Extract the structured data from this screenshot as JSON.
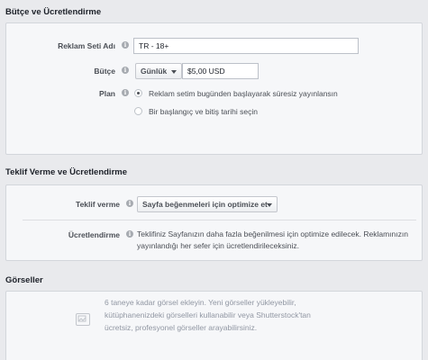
{
  "budget_section": {
    "title": "Bütçe ve Ücretlendirme",
    "ad_set_name_label": "Reklam Seti Adı",
    "ad_set_name_value": "TR - 18+",
    "budget_label": "Bütçe",
    "budget_type": "Günlük",
    "budget_amount": "$5,00 USD",
    "plan_label": "Plan",
    "plan_options": [
      {
        "label": "Reklam setim bugünden başlayarak süresiz yayınlansın",
        "selected": true
      },
      {
        "label": "Bir başlangıç ve bitiş tarihi seçin",
        "selected": false
      }
    ]
  },
  "bid_section": {
    "title": "Teklif Verme ve Ücretlendirme",
    "bid_label": "Teklif verme",
    "bid_value": "Sayfa beğenmeleri için optimize et",
    "charge_label": "Ücretlendirme",
    "charge_text_1": "Teklifiniz Sayfanızın daha fazla beğenilmesi için optimize edilecek. Reklamınızın",
    "charge_text_2": "yayınlandığı her sefer için ücretlendirileceksiniz."
  },
  "visuals_section": {
    "title": "Görseller",
    "upload_line_1": "6 taneye kadar görsel ekleyin. Yeni görseller yükleyebilir,",
    "upload_line_2": "kütüphanenizdeki görselleri kullanabilir veya Shutterstock'tan",
    "upload_line_3": "ücretsiz, profesyonel görseller arayabilirsiniz."
  },
  "icons": {
    "info": "info-icon",
    "caret": "caret-down-icon",
    "image": "image-gallery-icon"
  }
}
